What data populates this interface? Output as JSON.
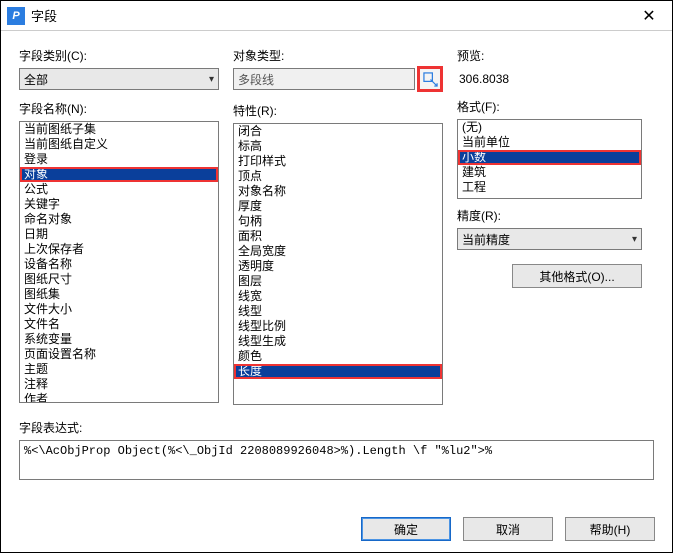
{
  "window": {
    "title": "字段",
    "icon_glyph": "P"
  },
  "labels": {
    "field_category": "字段类别(C):",
    "field_names": "字段名称(N):",
    "object_type": "对象类型:",
    "properties": "特性(R):",
    "preview": "预览:",
    "format": "格式(F):",
    "precision": "精度(R):",
    "expression": "字段表达式:"
  },
  "field_category": {
    "value": "全部"
  },
  "object_type": {
    "value": "多段线"
  },
  "preview": {
    "value": "306.8038"
  },
  "precision": {
    "value": "当前精度"
  },
  "field_names": {
    "items": [
      "当前图纸子集",
      "当前图纸自定义",
      "登录",
      "对象",
      "公式",
      "关键字",
      "命名对象",
      "日期",
      "上次保存者",
      "设备名称",
      "图纸尺寸",
      "图纸集",
      "文件大小",
      "文件名",
      "系统变量",
      "页面设置名称",
      "主题",
      "注释",
      "作者"
    ],
    "selected_index": 3
  },
  "properties": {
    "items": [
      "闭合",
      "标高",
      "打印样式",
      "顶点",
      "对象名称",
      "厚度",
      "句柄",
      "面积",
      "全局宽度",
      "透明度",
      "图层",
      "线宽",
      "线型",
      "线型比例",
      "线型生成",
      "颜色",
      "长度"
    ],
    "selected_index": 16
  },
  "formats": {
    "items": [
      "(无)",
      "当前单位",
      "小数",
      "建筑",
      "工程"
    ],
    "selected_index": 2
  },
  "buttons": {
    "other_format": "其他格式(O)...",
    "ok": "确定",
    "cancel": "取消",
    "help": "帮助(H)"
  },
  "expression": "%<\\AcObjProp Object(%<\\_ObjId 2208089926048>%).Length \\f \"%lu2\">%"
}
